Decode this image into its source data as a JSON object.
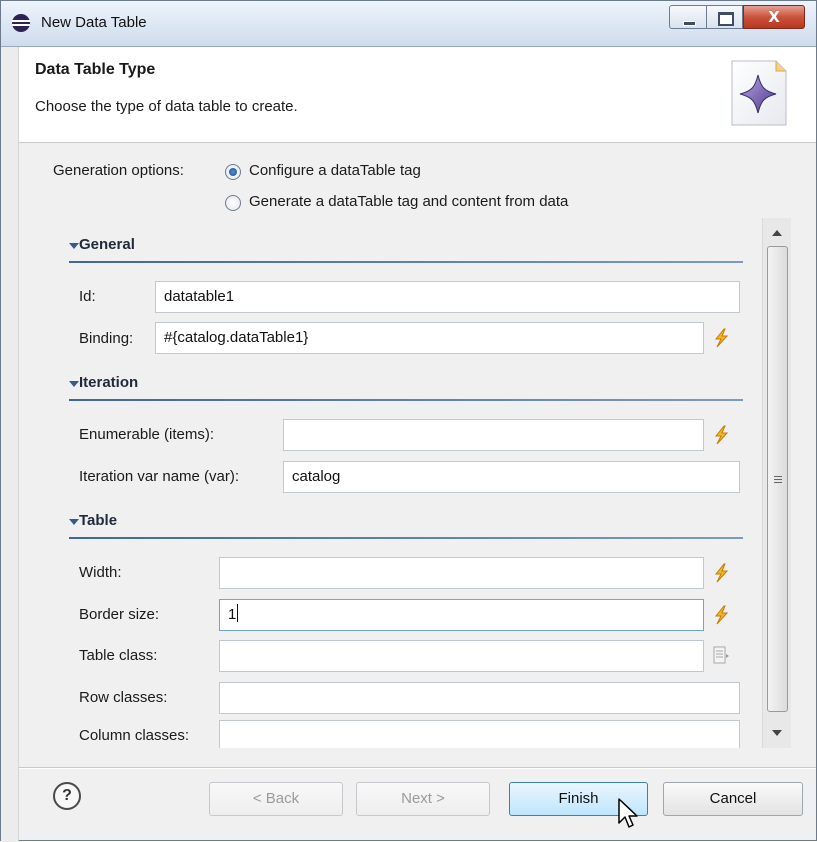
{
  "window": {
    "title": "New Data Table",
    "controls": {
      "minimize": "minimize",
      "maximize": "maximize",
      "close": "X"
    }
  },
  "header": {
    "title": "Data Table Type",
    "description": "Choose the type of data table to create.",
    "image": "wizard-banner-icon"
  },
  "generation": {
    "label": "Generation options:",
    "options": [
      {
        "label": "Configure a dataTable tag",
        "selected": true
      },
      {
        "label": "Generate a dataTable tag and content from data",
        "selected": false
      }
    ]
  },
  "sections": {
    "general": {
      "title": "General",
      "fields": {
        "id": {
          "label": "Id:",
          "value": "datatable1"
        },
        "binding": {
          "label": "Binding:",
          "value": "#{catalog.dataTable1}"
        }
      }
    },
    "iteration": {
      "title": "Iteration",
      "fields": {
        "enumerable": {
          "label": "Enumerable (items):",
          "value": ""
        },
        "var": {
          "label": "Iteration var name (var):",
          "value": "catalog"
        }
      }
    },
    "table": {
      "title": "Table",
      "fields": {
        "width": {
          "label": "Width:",
          "value": ""
        },
        "border": {
          "label": "Border size:",
          "value": "1"
        },
        "table_class": {
          "label": "Table class:",
          "value": ""
        },
        "row_classes": {
          "label": "Row classes:",
          "value": ""
        },
        "column_classes": {
          "label": "Column classes:",
          "value": ""
        }
      }
    }
  },
  "icons": {
    "bind": "lightning-bolt-icon",
    "picker": "css-class-picker-icon",
    "help": "help-icon"
  },
  "buttons": {
    "help": "?",
    "back": "< Back",
    "next": "Next >",
    "finish": "Finish",
    "cancel": "Cancel"
  },
  "colors": {
    "section_rule": "#3f6795",
    "bolt": "#e8a818",
    "primary_button": "#bee6fd"
  }
}
